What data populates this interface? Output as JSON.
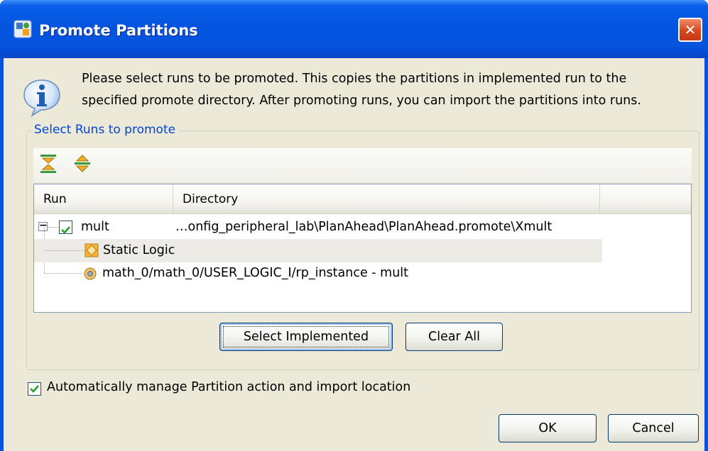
{
  "window": {
    "title": "Promote Partitions",
    "close_glyph": "✕"
  },
  "message": {
    "line1": "Please select runs to be promoted. This copies the partitions in implemented run to the",
    "line2": "specified promote directory. After promoting runs, you can import the partitions into runs."
  },
  "group": {
    "title": "Select Runs to promote",
    "toolbar_icons": [
      "collapse-all-icon",
      "expand-all-icon"
    ]
  },
  "table": {
    "columns": [
      "Run",
      "Directory"
    ],
    "rows": [
      {
        "run": "mult",
        "directory": "…onfig_peripheral_lab\\PlanAhead\\PlanAhead.promote\\Xmult",
        "checked": true,
        "expand_glyph": "−"
      },
      {
        "run": "Static Logic",
        "directory": ""
      },
      {
        "run": "math_0/math_0/USER_LOGIC_I/rp_instance - mult",
        "directory": ""
      }
    ]
  },
  "buttons": {
    "select_implemented": "Select Implemented",
    "clear_all": "Clear All",
    "ok": "OK",
    "cancel": "Cancel"
  },
  "auto_manage": {
    "label": "Automatically manage Partition action and import location",
    "checked": true
  },
  "colors": {
    "title_bar": "#0554e0",
    "dialog_bg": "#ece9d8",
    "group_title": "#0046d5",
    "close_button": "#d8461c"
  }
}
